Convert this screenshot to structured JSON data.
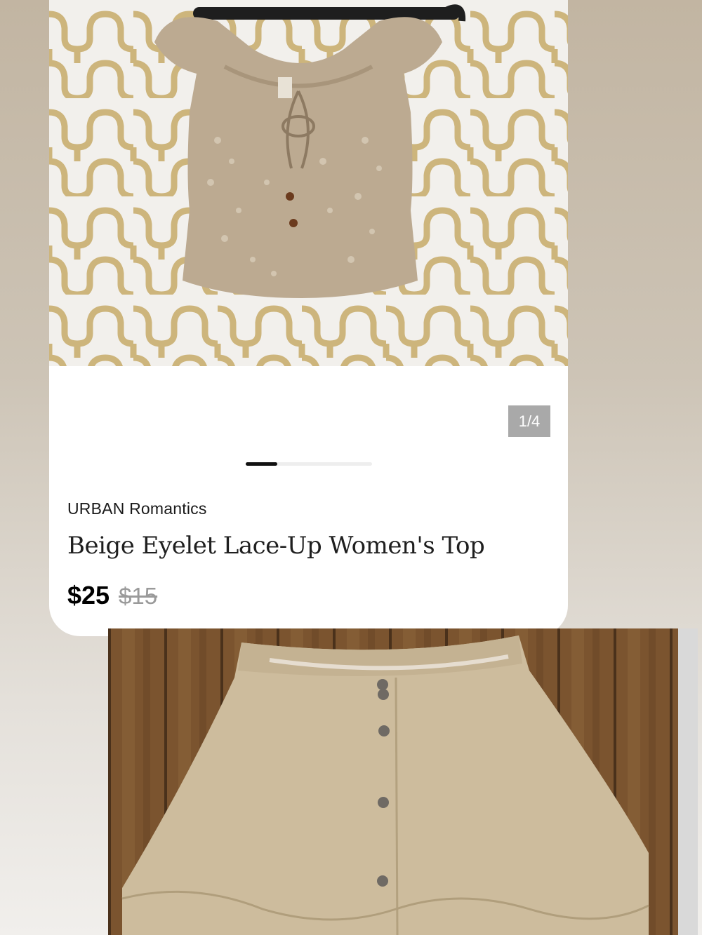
{
  "listing": {
    "image_counter": "1/4",
    "slide_progress": 0.25,
    "brand": "URBAN Romantics",
    "title": "Beige Eyelet Lace-Up Women's Top",
    "price": "$25",
    "original_price": "$15"
  },
  "colors": {
    "price": "#000000",
    "original_price": "#9a9a9a",
    "counter_bg": "#a9a9a9",
    "progress_active": "#111111"
  },
  "images": {
    "main": "beige-eyelet-top-on-hanger-photo",
    "next": "tan-suede-button-skirt-photo"
  }
}
